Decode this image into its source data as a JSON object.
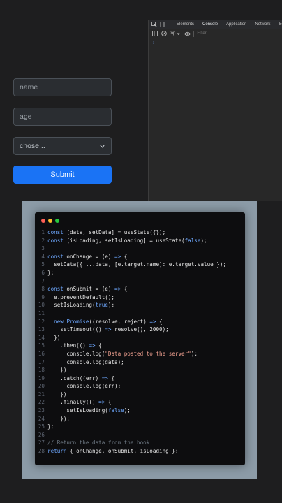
{
  "form": {
    "name_placeholder": "name",
    "age_placeholder": "age",
    "select_value": "chose...",
    "submit_label": "Submit"
  },
  "devtools": {
    "tabs": [
      "Elements",
      "Console",
      "Application",
      "Network",
      "So"
    ],
    "active_tab": "Console",
    "context": "top",
    "filter_placeholder": "Filter",
    "prompt": "›"
  },
  "colors": {
    "accent": "#1a73f5",
    "dot_red": "#ff5f56",
    "dot_yellow": "#ffbd2e",
    "dot_green": "#27c93f",
    "keyword": "#6ea8ff",
    "string": "#f0a090",
    "comment": "#6f7a85"
  },
  "code": {
    "lines": [
      [
        [
          "kw",
          "const"
        ],
        [
          "p",
          " [data, setData] = useState({});"
        ]
      ],
      [
        [
          "kw",
          "const"
        ],
        [
          "p",
          " [isLoading, setIsLoading] = useState("
        ],
        [
          "kw",
          "false"
        ],
        [
          "p",
          ");"
        ]
      ],
      [],
      [
        [
          "kw",
          "const"
        ],
        [
          "p",
          " onChange = (e) "
        ],
        [
          "kw",
          "=>"
        ],
        [
          "p",
          " {"
        ]
      ],
      [
        [
          "p",
          "  setData({ ...data, [e.target.name]: e.target.value });"
        ]
      ],
      [
        [
          "p",
          "};"
        ]
      ],
      [],
      [
        [
          "kw",
          "const"
        ],
        [
          "p",
          " onSubmit = (e) "
        ],
        [
          "kw",
          "=>"
        ],
        [
          "p",
          " {"
        ]
      ],
      [
        [
          "p",
          "  e.preventDefault();"
        ]
      ],
      [
        [
          "p",
          "  setIsLoading("
        ],
        [
          "kw",
          "true"
        ],
        [
          "p",
          ");"
        ]
      ],
      [],
      [
        [
          "p",
          "  "
        ],
        [
          "kw",
          "new"
        ],
        [
          "p",
          " "
        ],
        [
          "kw",
          "Promise"
        ],
        [
          "p",
          "((resolve, reject) "
        ],
        [
          "kw",
          "=>"
        ],
        [
          "p",
          " {"
        ]
      ],
      [
        [
          "p",
          "    setTimeout(() "
        ],
        [
          "kw",
          "=>"
        ],
        [
          "p",
          " resolve(), 2000);"
        ]
      ],
      [
        [
          "p",
          "  })"
        ]
      ],
      [
        [
          "p",
          "    .then(() "
        ],
        [
          "kw",
          "=>"
        ],
        [
          "p",
          " {"
        ]
      ],
      [
        [
          "p",
          "      console.log("
        ],
        [
          "str",
          "\"Data posted to the server\""
        ],
        [
          "p",
          ");"
        ]
      ],
      [
        [
          "p",
          "      console.log(data);"
        ]
      ],
      [
        [
          "p",
          "    })"
        ]
      ],
      [
        [
          "p",
          "    .catch((err) "
        ],
        [
          "kw",
          "=>"
        ],
        [
          "p",
          " {"
        ]
      ],
      [
        [
          "p",
          "      console.log(err);"
        ]
      ],
      [
        [
          "p",
          "    })"
        ]
      ],
      [
        [
          "p",
          "    .finally(() "
        ],
        [
          "kw",
          "=>"
        ],
        [
          "p",
          " {"
        ]
      ],
      [
        [
          "p",
          "      setIsLoading("
        ],
        [
          "kw",
          "false"
        ],
        [
          "p",
          ");"
        ]
      ],
      [
        [
          "p",
          "    });"
        ]
      ],
      [
        [
          "p",
          "};"
        ]
      ],
      [],
      [
        [
          "cm",
          "// Return the data from the hook"
        ]
      ],
      [
        [
          "kw",
          "return"
        ],
        [
          "p",
          " { onChange, onSubmit, isLoading };"
        ]
      ]
    ]
  }
}
